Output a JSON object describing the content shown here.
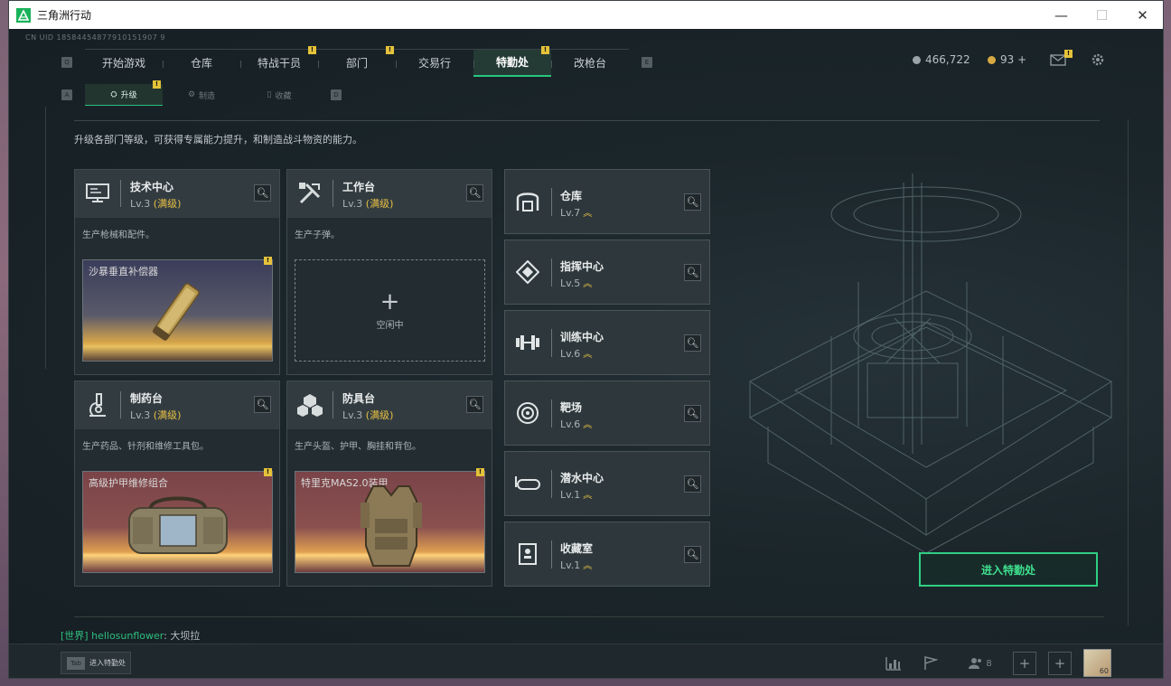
{
  "window": {
    "title": "三角洲行动",
    "minimize": "—",
    "maximize": "☐",
    "close": "✕"
  },
  "uid": "CN UID 18584454877910151907 9",
  "nav": {
    "left_key": "Q",
    "right_key": "E",
    "tabs": [
      "开始游戏",
      "仓库",
      "特战干员",
      "部门",
      "交易行",
      "特勤处",
      "改枪台"
    ],
    "active": "特勤处",
    "alert": "!"
  },
  "currency": {
    "silver": "466,722",
    "gold": "93 +"
  },
  "subnav": {
    "left_key": "A",
    "right_key": "D",
    "tabs": [
      "升级",
      "制造",
      "收藏"
    ],
    "active": "升级"
  },
  "description": "升级各部门等级，可获得专属能力提升，和制造战斗物资的能力。",
  "workshops": [
    {
      "name": "技术中心",
      "level": "Lv.3",
      "status": "(满级)",
      "desc": "生产枪械和配件。",
      "product": "沙暴垂直补偿器",
      "icon": "monitor-icon"
    },
    {
      "name": "工作台",
      "level": "Lv.3",
      "status": "(满级)",
      "desc": "生产子弹。",
      "idle_plus": "+",
      "idle_text": "空闲中",
      "icon": "tools-icon"
    },
    {
      "name": "制药台",
      "level": "Lv.3",
      "status": "(满级)",
      "desc": "生产药品、针剂和维修工具包。",
      "product": "高级护甲维修组合",
      "icon": "microscope-icon"
    },
    {
      "name": "防具台",
      "level": "Lv.3",
      "status": "(满级)",
      "desc": "生产头盔、护甲、胸挂和背包。",
      "product": "特里克MAS2.0装甲",
      "icon": "cubes-icon"
    }
  ],
  "facilities": [
    {
      "name": "仓库",
      "level": "Lv.7",
      "up": "︽",
      "icon": "warehouse-icon"
    },
    {
      "name": "指挥中心",
      "level": "Lv.5",
      "up": "︽",
      "icon": "command-icon"
    },
    {
      "name": "训练中心",
      "level": "Lv.6",
      "up": "︽",
      "icon": "dumbbell-icon"
    },
    {
      "name": "靶场",
      "level": "Lv.6",
      "up": "︽",
      "icon": "target-icon"
    },
    {
      "name": "潜水中心",
      "level": "Lv.1",
      "up": "︽",
      "icon": "goggles-icon"
    },
    {
      "name": "收藏室",
      "level": "Lv.1",
      "up": "︽",
      "icon": "trophy-icon"
    }
  ],
  "enter_button": "进入特勤处",
  "chat": {
    "channel": "[世界]",
    "user": "hellosunflower",
    "sep": ":",
    "message": "大坝拉"
  },
  "bottom": {
    "tab_key": "Tab",
    "tab_text": "进入特勤处",
    "friends_count": "8",
    "avatar_label": "60"
  },
  "colors": {
    "accent": "#27c77e",
    "max_level": "#e8c046",
    "background": "#1b262b"
  }
}
